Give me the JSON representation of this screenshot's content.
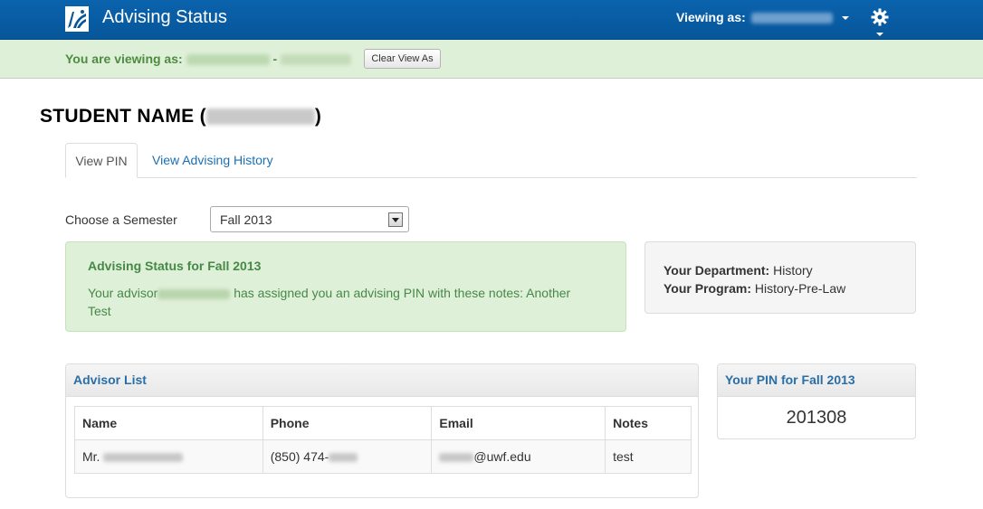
{
  "header": {
    "title": "Advising Status",
    "viewing_as_label": "Viewing as:"
  },
  "view_bar": {
    "label": "You are viewing as:",
    "separator": "-",
    "clear_button": "Clear View As"
  },
  "student": {
    "name_prefix": "STUDENT NAME (",
    "name_suffix": ")"
  },
  "tabs": [
    {
      "label": "View PIN",
      "active": true
    },
    {
      "label": "View Advising History",
      "active": false
    }
  ],
  "semester": {
    "label": "Choose a Semester",
    "selected": "Fall 2013"
  },
  "status": {
    "title": "Advising Status for Fall 2013",
    "text_before": "Your advisor",
    "text_after": "has assigned you an advising PIN with these notes: Another Test"
  },
  "department": {
    "dept_label": "Your Department:",
    "dept_value": "History",
    "program_label": "Your Program:",
    "program_value": "History-Pre-Law"
  },
  "advisor_list": {
    "title": "Advisor List",
    "columns": [
      "Name",
      "Phone",
      "Email",
      "Notes"
    ],
    "rows": [
      {
        "name_prefix": "Mr.",
        "phone_prefix": "(850) 474-",
        "email_suffix": "@uwf.edu",
        "notes": "test"
      }
    ]
  },
  "pin": {
    "title": "Your PIN for Fall 2013",
    "value": "201308"
  },
  "colors": {
    "navbar": "#07569a",
    "alert_bg": "#dff0d8",
    "alert_text": "#468847",
    "link": "#1b6fb3"
  }
}
